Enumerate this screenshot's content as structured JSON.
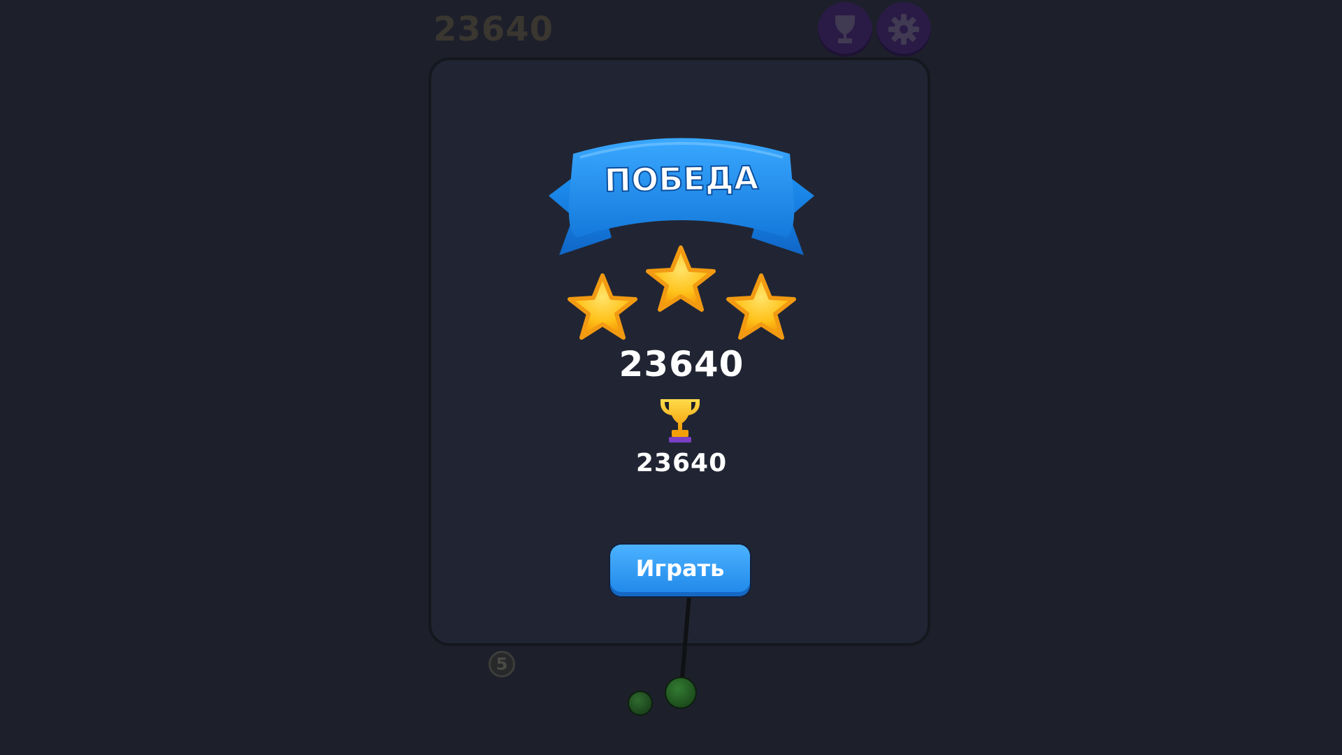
{
  "hud": {
    "score": "23640",
    "trophy_button_icon": "trophy-icon",
    "settings_button_icon": "gear-icon"
  },
  "board": {
    "lane_number": "5"
  },
  "victory": {
    "title": "ПОБЕДА",
    "stars_earned": 3,
    "stars_total": 3,
    "score": "23640",
    "best_score": "23640",
    "best_icon": "trophy-icon",
    "play_button_label": "Играть"
  },
  "colors": {
    "background": "#1d202b",
    "ribbon_blue": "#1e88e5",
    "star_gold": "#ffc21a",
    "button_blue": "#2a99f5",
    "hud_purple": "#2a1b46"
  }
}
